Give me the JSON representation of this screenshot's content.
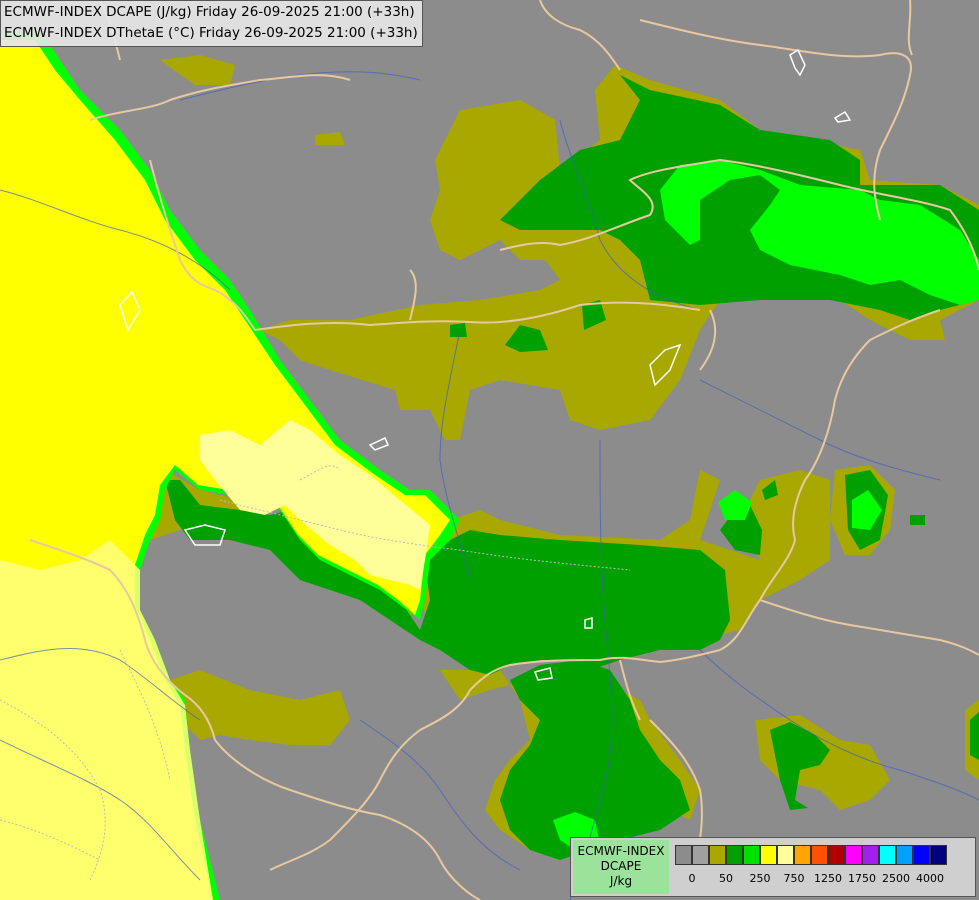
{
  "titles": {
    "line1": "ECMWF-INDEX DCAPE (J/kg) Friday 26-09-2025 21:00 (+33h)",
    "line2": "ECMWF-INDEX DThetaE (°C) Friday 26-09-2025 21:00 (+33h)"
  },
  "legend": {
    "model": "ECMWF-INDEX",
    "parameter": "DCAPE",
    "unit": "J/kg",
    "colors": [
      "#8c8c8c",
      "#a0a0a0",
      "#a8a800",
      "#00a000",
      "#00e000",
      "#ffff00",
      "#ffff99",
      "#ffa500",
      "#ff5000",
      "#b00000",
      "#ff00ff",
      "#a020f0",
      "#00ffff",
      "#00a0ff",
      "#0000ff",
      "#00007f"
    ],
    "tick_labels": [
      "0",
      "50",
      "250",
      "750",
      "1250",
      "1750",
      "2500",
      "4000"
    ]
  },
  "colors": {
    "background": "#8c8c8c",
    "olive": "#a8a800",
    "dark_green": "#00a000",
    "bright_green": "#00ff00",
    "yellow": "#ffff00",
    "light_yellow": "#ffff99",
    "pale_yellow": "#ffff7f",
    "border_line": "#e8c8a0",
    "river": "#4060c0"
  }
}
